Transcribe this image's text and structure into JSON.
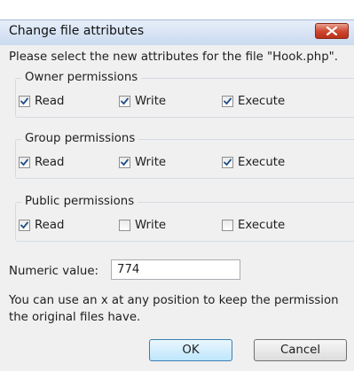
{
  "window": {
    "title": "Change file attributes"
  },
  "prompt": "Please select the new attributes for the file \"Hook.php\".",
  "groups": [
    {
      "label": "Owner permissions",
      "read": {
        "label": "Read",
        "checked": true
      },
      "write": {
        "label": "Write",
        "checked": true
      },
      "execute": {
        "label": "Execute",
        "checked": true
      }
    },
    {
      "label": "Group permissions",
      "read": {
        "label": "Read",
        "checked": true
      },
      "write": {
        "label": "Write",
        "checked": true
      },
      "execute": {
        "label": "Execute",
        "checked": true
      }
    },
    {
      "label": "Public permissions",
      "read": {
        "label": "Read",
        "checked": true
      },
      "write": {
        "label": "Write",
        "checked": false
      },
      "execute": {
        "label": "Execute",
        "checked": false
      }
    }
  ],
  "numeric": {
    "label": "Numeric value:",
    "value": "774"
  },
  "help": "You can use an x at any position to keep the permission\nthe original files have.",
  "buttons": {
    "ok": "OK",
    "cancel": "Cancel"
  },
  "colors": {
    "close_button": "#cf4a32",
    "dialog_background": "#f0f0f0",
    "checkmark": "#1f4e87"
  }
}
